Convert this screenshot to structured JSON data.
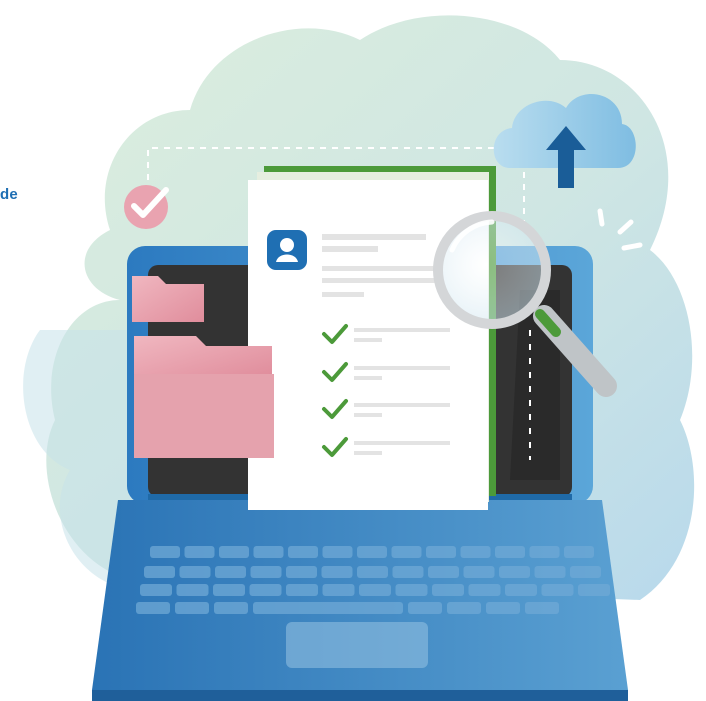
{
  "edge_text": "de",
  "colors": {
    "accent_text": "#1f6fb3",
    "cloud_light": "#d7ead6",
    "cloud_blue": "#b9d9ea",
    "laptop_blue": "#2f7fc1",
    "laptop_dark": "#1d5f99",
    "screen_dark": "#333333",
    "document": "#ffffff",
    "doc_line": "#e3e3e3",
    "check_green": "#4c9a3a",
    "folder_pink": "#e7a1ac",
    "badge_pink": "#e9a3b0",
    "upload_cloud": "#a9d2ea",
    "upload_arrow": "#1a5d98",
    "magnifier_rim": "#c9c9c9"
  },
  "icons": [
    "check-badge-icon",
    "folder-icon",
    "user-avatar-icon",
    "checkmark-icon",
    "cloud-upload-icon",
    "magnifying-glass-icon",
    "sparkle-lines-icon",
    "laptop-keyboard-icon"
  ]
}
